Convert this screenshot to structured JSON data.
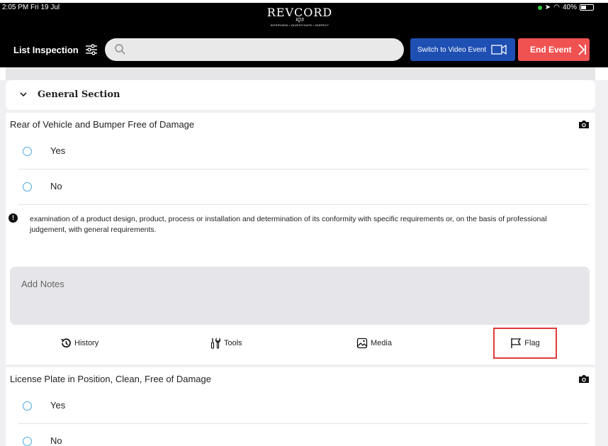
{
  "status_bar": {
    "time": "2:05 PM  Fri 19 Jul",
    "battery": "40%"
  },
  "logo": {
    "title": "REVCORD",
    "sub": "IQ3",
    "tagline": "INTERVIEW • INVESTIGATE • INSPECT"
  },
  "header": {
    "title": "List Inspection",
    "search_placeholder": "",
    "video_button": "Switch to Video Event",
    "end_button": "End Event"
  },
  "section": {
    "title": "General Section"
  },
  "questions": [
    {
      "title": "Rear of Vehicle and Bumper Free of Damage",
      "options": [
        "Yes",
        "No"
      ],
      "info": "examination of a product design, product, process or installation and determination of its conformity with specific requirements or, on the basis of professional judgement, with general requirements.",
      "notes_placeholder": "Add Notes",
      "actions": {
        "history": "History",
        "tools": "Tools",
        "media": "Media",
        "flag": "Flag"
      }
    },
    {
      "title": "License Plate in Position, Clean, Free of Damage",
      "options": [
        "Yes",
        "No"
      ]
    }
  ],
  "colors": {
    "video_button": "#1e4fb3",
    "end_button": "#f05252",
    "radio": "#4aa8e0",
    "flag_highlight": "#e03a3a"
  }
}
